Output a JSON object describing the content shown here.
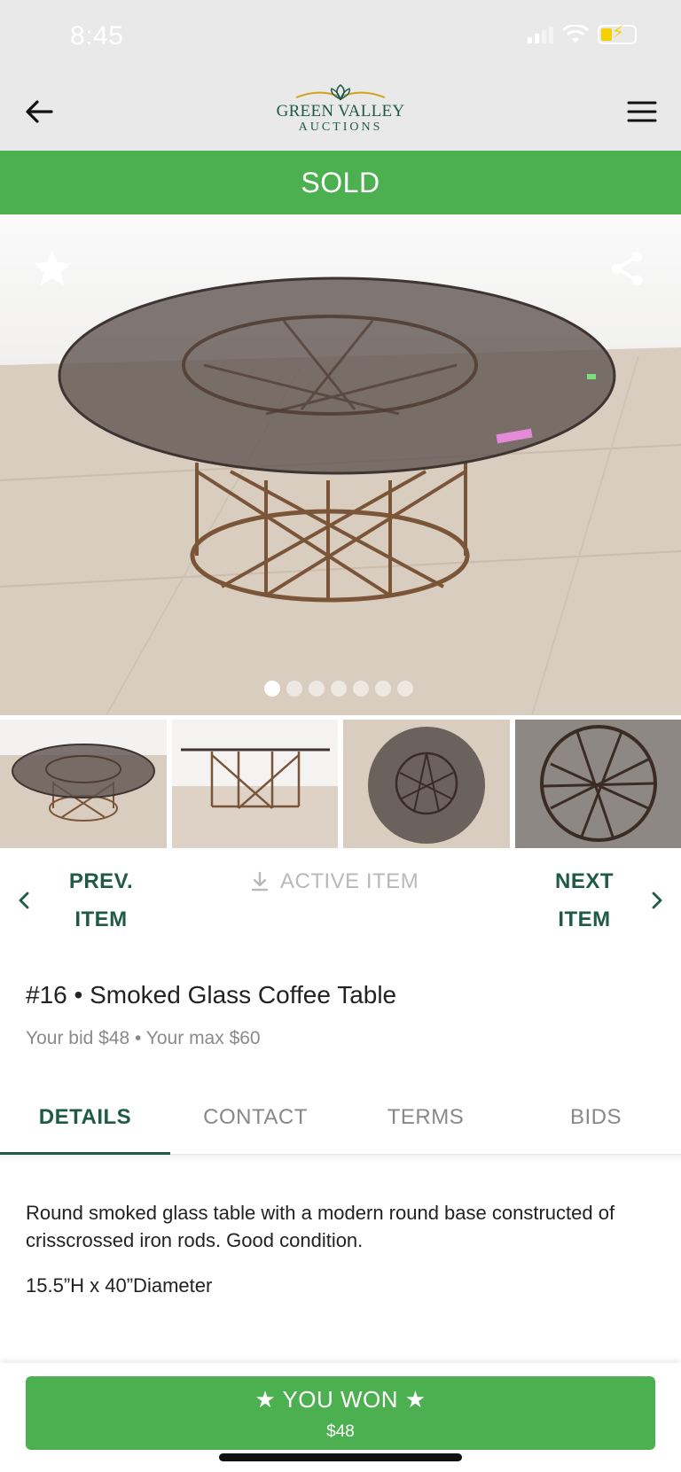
{
  "status_bar": {
    "time": "8:45"
  },
  "header": {
    "logo_line1": "GREEN VALLEY",
    "logo_line2": "AUCTIONS",
    "back_icon": "arrow-left-icon",
    "menu_icon": "hamburger-menu-icon"
  },
  "banner": {
    "status": "SOLD"
  },
  "gallery": {
    "image_count": 7,
    "active_index": 0,
    "favorite_icon": "star-icon",
    "share_icon": "share-icon",
    "thumbnail_count": 4
  },
  "item_nav": {
    "prev_line1": "PREV.",
    "prev_line2": "ITEM",
    "active_label": "ACTIVE ITEM",
    "next_line1": "NEXT",
    "next_line2": "ITEM"
  },
  "item": {
    "title": "#16 • Smoked Glass Coffee Table",
    "bid_info": "Your bid $48 • Your max $60"
  },
  "tabs": [
    {
      "label": "DETAILS",
      "active": true
    },
    {
      "label": "CONTACT",
      "active": false
    },
    {
      "label": "TERMS",
      "active": false
    },
    {
      "label": "BIDS",
      "active": false
    }
  ],
  "details": {
    "description": "Round smoked glass table with a modern round base constructed of crisscrossed iron rods. Good condition.",
    "dimensions": "15.5”H x 40”Diameter"
  },
  "result_button": {
    "label": "★ YOU WON ★",
    "amount": "$48"
  },
  "colors": {
    "primary_green": "#4caf50",
    "dark_green": "#1f5a47",
    "header_bg": "#e9e9e9"
  }
}
